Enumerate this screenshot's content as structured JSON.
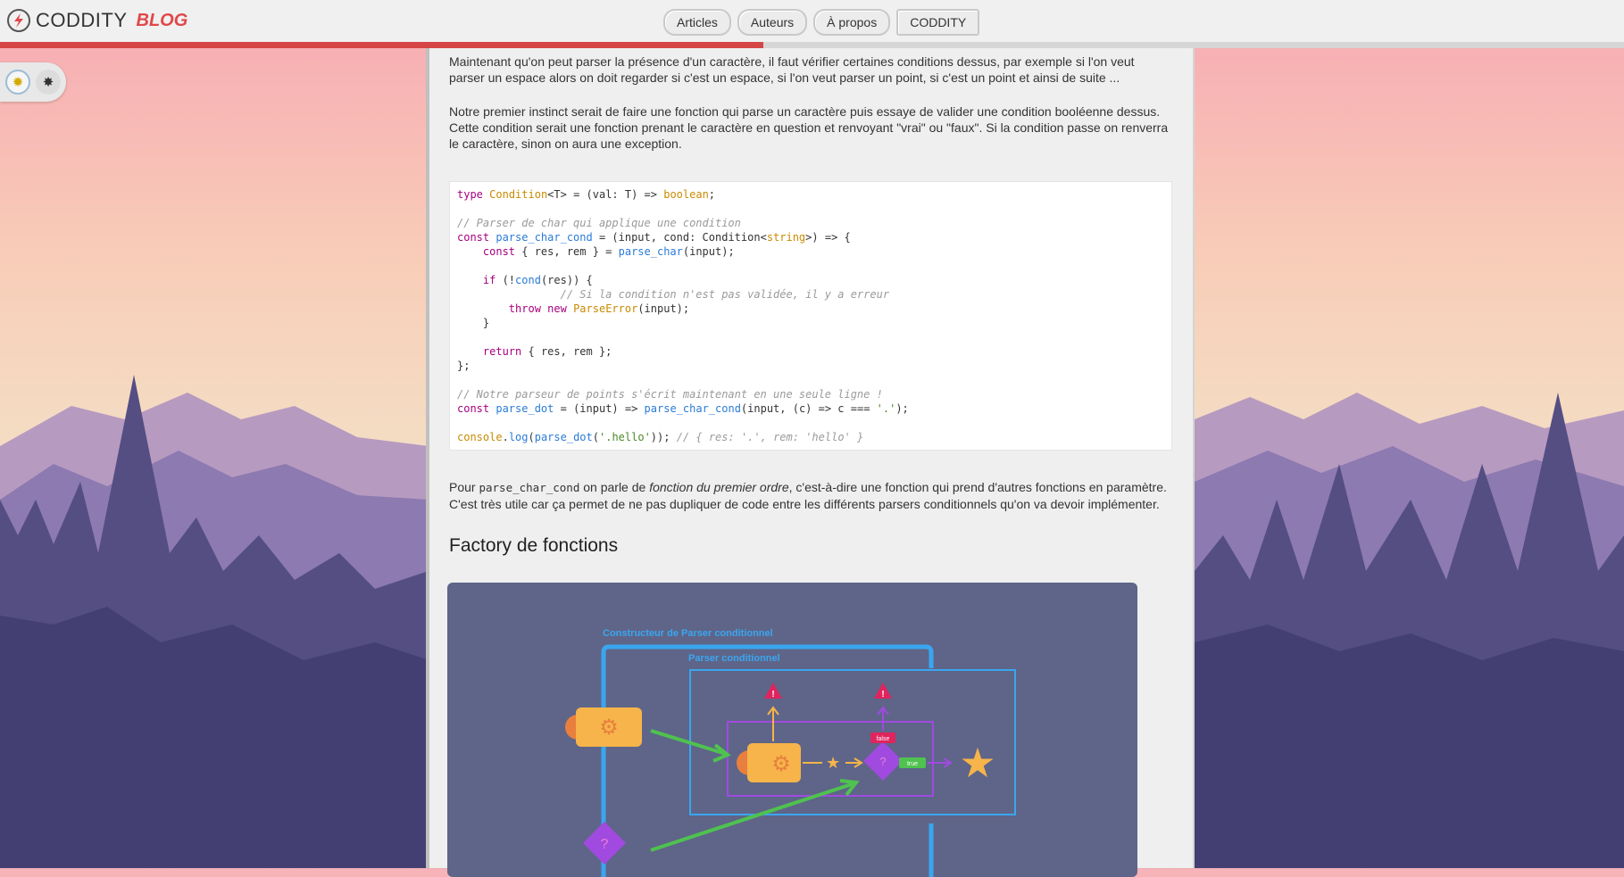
{
  "header": {
    "logo_text": "CODDITY",
    "logo_suffix": "BLOG",
    "nav": [
      "Articles",
      "Auteurs",
      "À propos",
      "CODDITY"
    ]
  },
  "reading_progress_percent": 47,
  "theme": {
    "light_icon": "sun-icon",
    "dark_icon": "moon-icon"
  },
  "article": {
    "p1": "Maintenant qu'on peut parser la présence d'un caractère, il faut vérifier certaines conditions dessus, par exemple si l'on veut parser un espace alors on doit regarder si c'est un espace, si l'on veut parser un point, si c'est un point et ainsi de suite ...",
    "p2": "Notre premier instinct serait de faire une fonction qui parse un caractère puis essaye de valider une condition booléenne dessus. Cette condition serait une fonction prenant le caractère en question et renvoyant \"vrai\" ou \"faux\". Si la condition passe on renverra le caractère, sinon on aura une exception.",
    "p3_before": "Pour ",
    "p3_code": "parse_char_cond",
    "p3_mid": " on parle de ",
    "p3_em": "fonction du premier ordre",
    "p3_after": ", c'est-à-dire une fonction qui prend d'autres fonctions en paramètre. C'est très utile car ça permet de ne pas dupliquer de code entre les différents parsers conditionnels qu'on va devoir implémenter.",
    "section_title": "Factory de fonctions",
    "diagram_labels": {
      "outer": "Constructeur de Parser conditionnel",
      "inner": "Parser conditionnel",
      "false": "false",
      "true": "true"
    }
  },
  "code_lines": [
    "type Condition<T> = (val: T) => boolean;",
    "",
    "// Parser de char qui applique une condition",
    "const parse_char_cond = (input, cond: Condition<string>) => {",
    "    const { res, rem } = parse_char(input);",
    "",
    "    if (!cond(res)) {",
    "        // Si la condition n'est pas validée, il y a erreur",
    "        throw new ParseError(input);",
    "    }",
    "",
    "    return { res, rem };",
    "};",
    "",
    "// Notre parseur de points s'écrit maintenant en une seule ligne !",
    "const parse_dot = (input) => parse_char_cond(input, (c) => c === '.');",
    "",
    "console.log(parse_dot('.hello')); // { res: '.', rem: 'hello' }"
  ],
  "colors": {
    "accent": "#d64545",
    "diagram_bg": "#5e6588",
    "diagram_blue": "#3aa6f0",
    "diagram_purple": "#a04ae0",
    "diagram_orange": "#f6b44a",
    "diagram_green": "#4fc24f"
  }
}
